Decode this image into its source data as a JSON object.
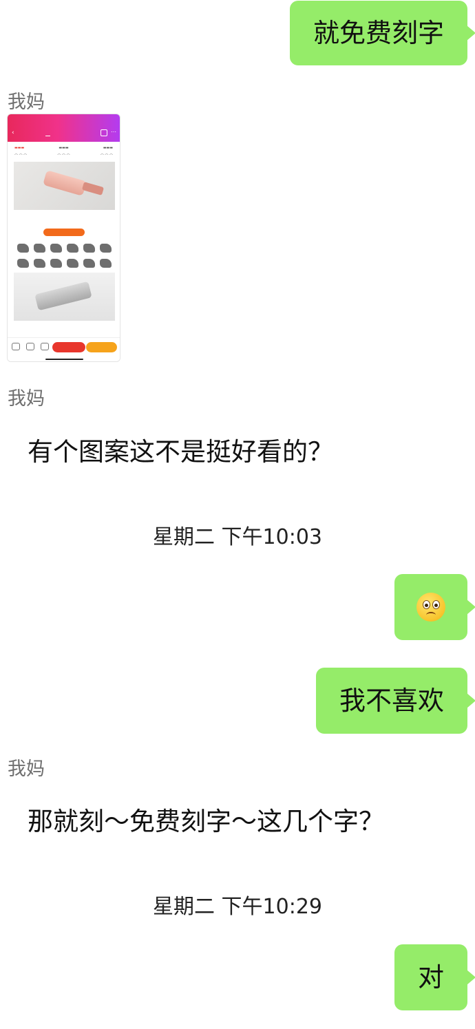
{
  "messages": {
    "m1": {
      "text": "就免费刻字"
    },
    "sender_name": "我妈",
    "m3": {
      "text": "有个图案这不是挺好看的？"
    },
    "time1": "星期二 下午10:03",
    "m4": {
      "emoji": "frown-emoji"
    },
    "m5": {
      "text": "我不喜欢"
    },
    "m6": {
      "text": "那就刻～免费刻字～这几个字？"
    },
    "time2": "星期二 下午10:29",
    "m7": {
      "text": "对"
    }
  },
  "colors": {
    "my_bubble": "#95ec69",
    "background": "#ffffff",
    "sender_name": "#6f6f6f"
  }
}
